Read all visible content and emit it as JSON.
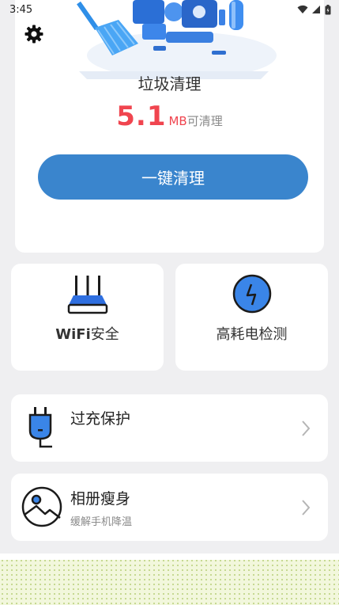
{
  "status_bar": {
    "time": "3:45",
    "icons": [
      "wifi-icon",
      "signal-icon",
      "battery-icon"
    ]
  },
  "clean_card": {
    "title": "垃圾清理",
    "amount": "5.1",
    "unit": "MB",
    "suffix": "可清理",
    "button_label": "一键清理",
    "settings_icon": "gear-icon"
  },
  "tiles": {
    "wifi": {
      "label_bold": "WiFi",
      "label_rest": "安全",
      "icon": "router-icon"
    },
    "power": {
      "label": "高耗电检测",
      "icon": "lightning-icon"
    }
  },
  "rows": {
    "charge": {
      "title": "过充保护",
      "icon": "plug-icon"
    },
    "album": {
      "title": "相册瘦身",
      "subtitle": "缓解手机降温",
      "icon": "photo-icon"
    }
  },
  "colors": {
    "accent": "#3a85cd",
    "amount": "#f0454f",
    "background": "#efeff1"
  }
}
